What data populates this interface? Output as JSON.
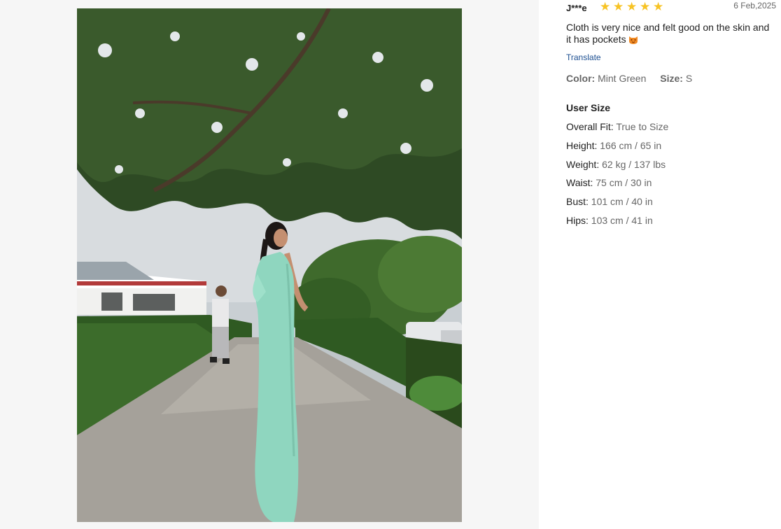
{
  "review": {
    "reviewer": "J***e",
    "rating": 5,
    "rating_icon": "star-icon",
    "star_color": "#f7c325",
    "date": "6 Feb,2025",
    "text": "Cloth is very nice and felt good on the skin and it has pockets",
    "emoji": "smiling-cat-emoji",
    "translate_label": "Translate",
    "color_label": "Color:",
    "color_value": "Mint Green",
    "size_label": "Size:",
    "size_value": "S"
  },
  "user_size": {
    "title": "User Size",
    "rows": [
      {
        "label": "Overall Fit:",
        "value": "True to Size"
      },
      {
        "label": "Height:",
        "value": "166 cm / 65 in"
      },
      {
        "label": "Weight:",
        "value": "62 kg / 137 lbs"
      },
      {
        "label": "Waist:",
        "value": "75 cm / 30 in"
      },
      {
        "label": "Bust:",
        "value": "101 cm / 40 in"
      },
      {
        "label": "Hips:",
        "value": "103 cm / 41 in"
      }
    ]
  },
  "photo": {
    "subject": "review-photo",
    "dress_color": "#8fd6bf"
  }
}
